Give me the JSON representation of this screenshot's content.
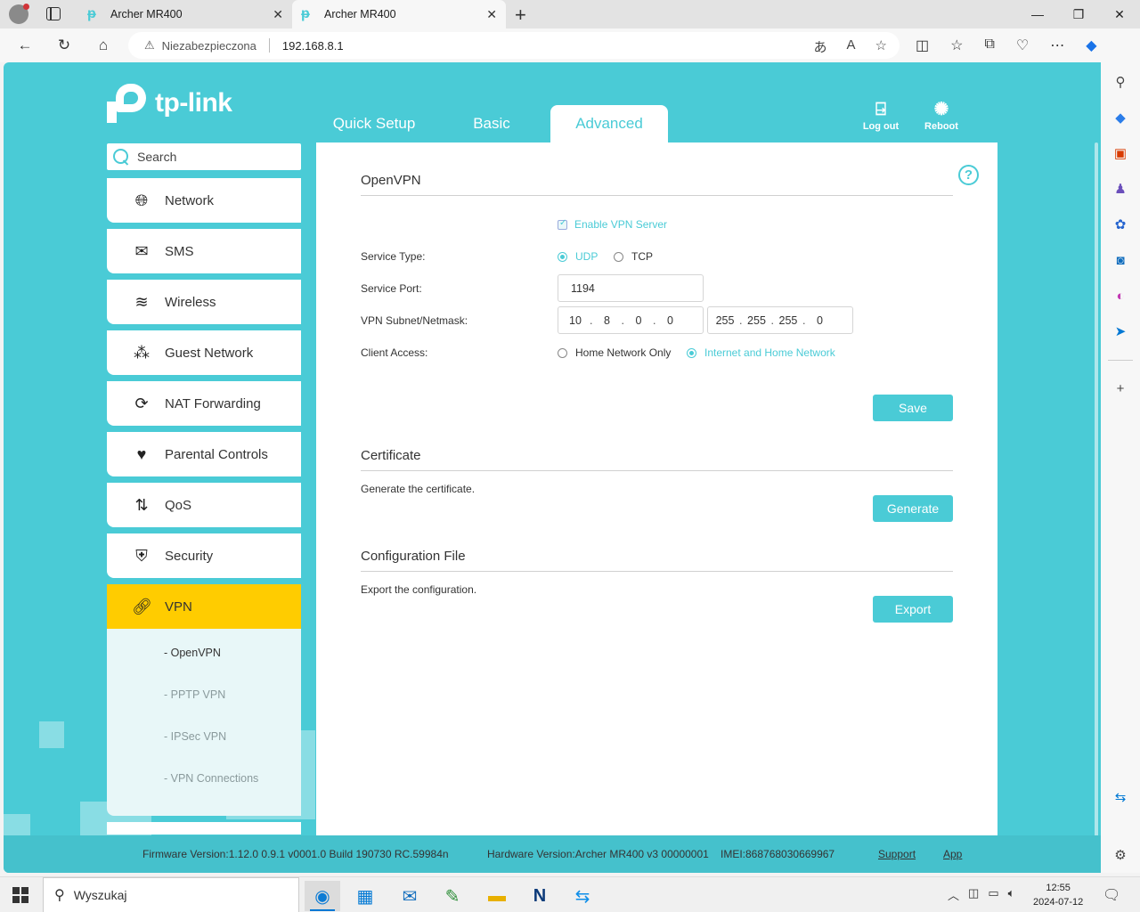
{
  "browser": {
    "tabs": [
      {
        "title": "Archer MR400"
      },
      {
        "title": "Archer MR400"
      }
    ],
    "address": {
      "security_label": "Niezabezpieczona",
      "url": "192.168.8.1"
    }
  },
  "router": {
    "brand": "tp-link",
    "nav": {
      "quick_setup": "Quick Setup",
      "basic": "Basic",
      "advanced": "Advanced"
    },
    "top_actions": {
      "logout": "Log out",
      "reboot": "Reboot"
    },
    "search": {
      "placeholder": "Search"
    },
    "menu": [
      {
        "label": "Network",
        "icon": "globe-icon"
      },
      {
        "label": "SMS",
        "icon": "envelope-icon"
      },
      {
        "label": "Wireless",
        "icon": "wifi-icon"
      },
      {
        "label": "Guest Network",
        "icon": "guests-icon"
      },
      {
        "label": "NAT Forwarding",
        "icon": "nat-icon"
      },
      {
        "label": "Parental Controls",
        "icon": "heart-icon"
      },
      {
        "label": "QoS",
        "icon": "arrows-icon"
      },
      {
        "label": "Security",
        "icon": "shield-icon"
      },
      {
        "label": "VPN",
        "icon": "link-icon"
      }
    ],
    "vpn_submenu": [
      {
        "label": "- OpenVPN"
      },
      {
        "label": "- PPTP VPN"
      },
      {
        "label": "- IPSec VPN"
      },
      {
        "label": "- VPN Connections"
      }
    ],
    "openvpn": {
      "title": "OpenVPN",
      "enable_label": "Enable VPN Server",
      "enable_checked": true,
      "service_type_label": "Service Type:",
      "udp": "UDP",
      "tcp": "TCP",
      "service_type_selected": "UDP",
      "service_port_label": "Service Port:",
      "service_port": "1194",
      "subnet_label": "VPN Subnet/Netmask:",
      "subnet": [
        "10",
        "8",
        "0",
        "0"
      ],
      "netmask": [
        "255",
        "255",
        "255",
        "0"
      ],
      "client_access_label": "Client Access:",
      "home_only": "Home Network Only",
      "internet_home": "Internet and Home Network",
      "client_access_selected": "Internet and Home Network",
      "save": "Save"
    },
    "certificate": {
      "title": "Certificate",
      "desc": "Generate the certificate.",
      "button": "Generate"
    },
    "config_file": {
      "title": "Configuration File",
      "desc": "Export the configuration.",
      "button": "Export"
    },
    "footer": {
      "firmware": "Firmware Version:1.12.0 0.9.1 v0001.0 Build 190730 RC.59984n",
      "hardware": "Hardware Version:Archer MR400 v3 00000001",
      "imei": "IMEI:868768030669967",
      "support": "Support",
      "app": "App"
    }
  },
  "taskbar": {
    "search_placeholder": "Wyszukaj",
    "time": "12:55",
    "date": "2024-07-12"
  },
  "colors": {
    "accent": "#4acbd6",
    "active_menu": "#ffcc00"
  }
}
